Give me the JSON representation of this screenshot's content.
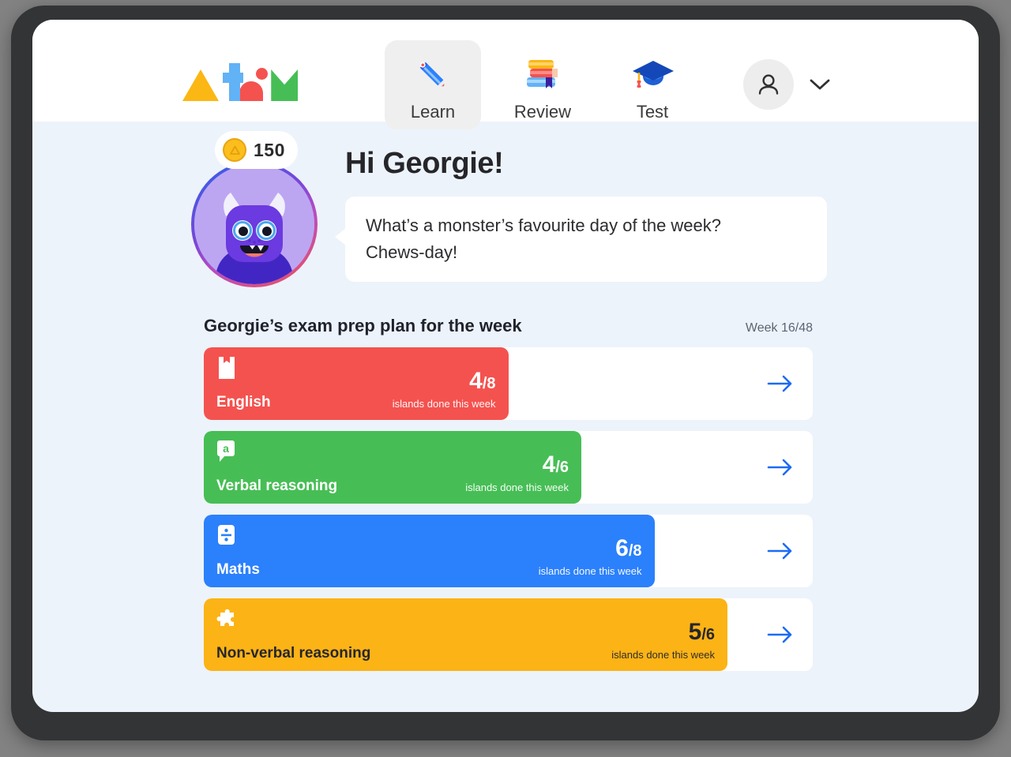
{
  "app": {
    "logo_name": "atom-logo",
    "brand_colors": {
      "yellow": "#FBB713",
      "blue": "#62B2F6",
      "red": "#F4524F",
      "green": "#46BE55"
    }
  },
  "nav": {
    "items": [
      {
        "label": "Learn",
        "icon": "pencil-icon",
        "active": true
      },
      {
        "label": "Review",
        "icon": "book-stack-icon",
        "active": false
      },
      {
        "label": "Test",
        "icon": "graduation-cap-icon",
        "active": false
      }
    ]
  },
  "account": {
    "avatar_icon": "person-icon",
    "chevron_icon": "chevron-down-icon"
  },
  "hero": {
    "coins": "150",
    "coin_icon": "coin-icon",
    "avatar_character": "monster-avatar",
    "greeting": "Hi Georgie!",
    "joke_line_1": "What’s a monster’s favourite day of the week?",
    "joke_line_2": "Chews-day!"
  },
  "plan": {
    "title": "Georgie’s exam prep plan for the week",
    "week": "Week 16/48",
    "islands_caption": "islands done this week",
    "arrow_icon": "arrow-right-icon",
    "subjects": [
      {
        "name": "English",
        "icon": "bookmark-icon",
        "done": "4",
        "total": "/8",
        "color": "#F4524F",
        "percent": 50,
        "dark_text": false
      },
      {
        "name": "Verbal reasoning",
        "icon": "speech-bubble-a-icon",
        "done": "4",
        "total": "/6",
        "color": "#46BE55",
        "percent": 62,
        "dark_text": false
      },
      {
        "name": "Maths",
        "icon": "division-sign-icon",
        "done": "6",
        "total": "/8",
        "color": "#2B80FC",
        "percent": 74,
        "dark_text": false
      },
      {
        "name": "Non-verbal reasoning",
        "icon": "puzzle-piece-icon",
        "done": "5",
        "total": "/6",
        "color": "#FCB316",
        "percent": 86,
        "dark_text": true
      }
    ]
  }
}
